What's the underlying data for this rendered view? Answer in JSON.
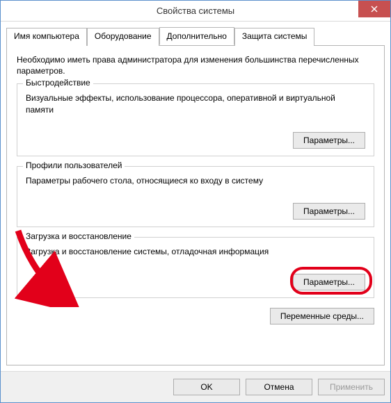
{
  "window": {
    "title": "Свойства системы"
  },
  "tabs": [
    {
      "label": "Имя компьютера"
    },
    {
      "label": "Оборудование"
    },
    {
      "label": "Дополнительно"
    },
    {
      "label": "Защита системы"
    }
  ],
  "intro": "Необходимо иметь права администратора для изменения большинства перечисленных параметров.",
  "groups": {
    "perf": {
      "legend": "Быстродействие",
      "desc": "Визуальные эффекты, использование процессора, оперативной и виртуальной памяти",
      "button": "Параметры..."
    },
    "profiles": {
      "legend": "Профили пользователей",
      "desc": "Параметры рабочего стола, относящиеся ко входу в систему",
      "button": "Параметры..."
    },
    "startup": {
      "legend": "Загрузка и восстановление",
      "desc": "Загрузка и восстановление системы, отладочная информация",
      "button": "Параметры..."
    }
  },
  "env_button": "Переменные среды...",
  "buttons": {
    "ok": "OK",
    "cancel": "Отмена",
    "apply": "Применить"
  }
}
